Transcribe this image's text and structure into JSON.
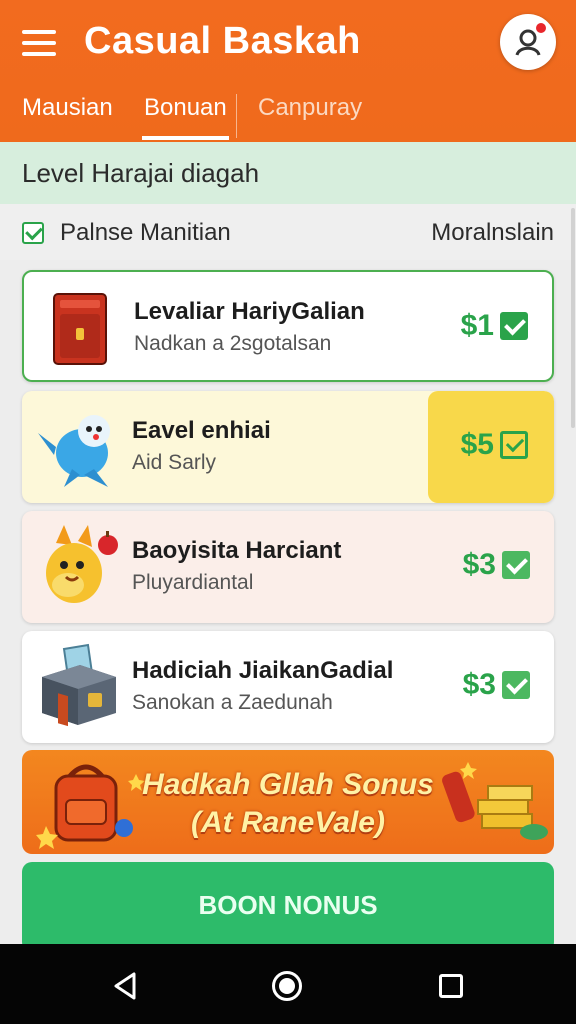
{
  "header": {
    "menu_icon": "hamburger-menu-icon",
    "title": "Casual Baskah",
    "avatar_icon": "user-avatar-icon",
    "tabs": [
      {
        "label": "Mausian"
      },
      {
        "label": "Bonuan"
      },
      {
        "label": "Canpuray"
      }
    ],
    "accent_color": "#ef6a1c"
  },
  "level": {
    "text": "Level Harajai diagah"
  },
  "filter": {
    "label": "Palnse Manitian",
    "right_text": "Moralnslain",
    "checked": true
  },
  "items": [
    {
      "title": "Levaliar HariyGalian",
      "subtitle": "Nadkan a 2sgotalsan",
      "price": "$1",
      "icon": "red-mailbox-icon"
    },
    {
      "title": "Eavel enhiai",
      "subtitle": "Aid Sarly",
      "price": "$5",
      "icon": "blue-bird-icon"
    },
    {
      "title": "Baoyisita Harciant",
      "subtitle": "Pluyardiantal",
      "price": "$3",
      "icon": "yellow-fox-icon"
    },
    {
      "title": "Hadiciah JiaikanGadial",
      "subtitle": "Sanokan a Zaedunah",
      "price": "$3",
      "icon": "treasure-chest-icon"
    }
  ],
  "banner": {
    "line1": "Hadkah Gllah Sonus",
    "line2": "(At RaneVale)",
    "left_icon": "backpack-icon",
    "right_icon": "gold-bars-icon"
  },
  "bonus_button": {
    "label": "BOON NONUS",
    "color": "#2dbb6a"
  },
  "navbar": {
    "back_icon": "back-triangle-icon",
    "home_icon": "home-circle-icon",
    "recent_icon": "recent-apps-square-icon"
  }
}
